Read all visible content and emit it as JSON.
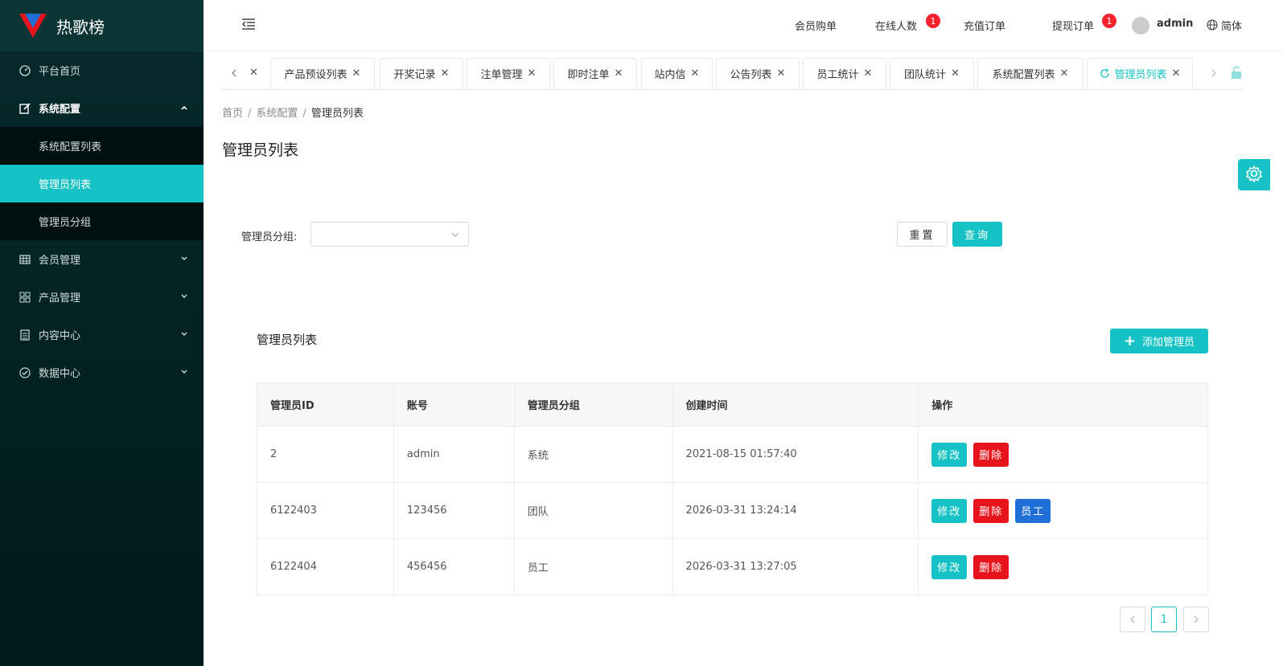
{
  "app": {
    "title": "热歌榜"
  },
  "sidebar": {
    "items": [
      {
        "label": "平台首页",
        "icon": "dashboard-icon"
      },
      {
        "label": "系统配置",
        "icon": "edit-icon",
        "open": true,
        "children": [
          {
            "label": "系统配置列表"
          },
          {
            "label": "管理员列表",
            "active": true
          },
          {
            "label": "管理员分组"
          }
        ]
      },
      {
        "label": "会员管理",
        "icon": "grid-icon"
      },
      {
        "label": "产品管理",
        "icon": "apps-icon"
      },
      {
        "label": "内容中心",
        "icon": "document-icon"
      },
      {
        "label": "数据中心",
        "icon": "check-circle-icon"
      }
    ]
  },
  "header": {
    "nav": [
      {
        "label": "会员购单"
      },
      {
        "label": "在线人数",
        "badge": "1"
      },
      {
        "label": "充值订单"
      },
      {
        "label": "提现订单",
        "badge": "1"
      }
    ],
    "user": "admin",
    "lang": "简体"
  },
  "tabs": [
    {
      "label": "产品预设列表"
    },
    {
      "label": "开奖记录"
    },
    {
      "label": "注单管理"
    },
    {
      "label": "即时注单"
    },
    {
      "label": "站内信"
    },
    {
      "label": "公告列表"
    },
    {
      "label": "员工统计"
    },
    {
      "label": "团队统计"
    },
    {
      "label": "系统配置列表"
    },
    {
      "label": "管理员列表",
      "active": true
    }
  ],
  "breadcrumb": [
    "首页",
    "系统配置",
    "管理员列表"
  ],
  "page_title": "管理员列表",
  "filter": {
    "group_label": "管理员分组:",
    "group_value": "",
    "reset_label": "重置",
    "query_label": "查询"
  },
  "table": {
    "title": "管理员列表",
    "add_label": "添加管理员",
    "columns": [
      "管理员ID",
      "账号",
      "管理员分组",
      "创建时间",
      "操作"
    ],
    "rows": [
      {
        "id": "2",
        "account": "admin",
        "group": "系统",
        "created": "2021-08-15 01:57:40",
        "actions": [
          "修改",
          "删除"
        ]
      },
      {
        "id": "6122403",
        "account": "123456",
        "group": "团队",
        "created": "2026-03-31 13:24:14",
        "actions": [
          "修改",
          "删除",
          "员工"
        ]
      },
      {
        "id": "6122404",
        "account": "456456",
        "group": "员工",
        "created": "2026-03-31 13:27:05",
        "actions": [
          "修改",
          "删除"
        ]
      }
    ]
  },
  "pagination": {
    "current": "1"
  },
  "colors": {
    "accent": "#16c2c5",
    "danger": "#e8141c",
    "primary": "#1f6fd6",
    "sidebar": "#062a2c"
  }
}
